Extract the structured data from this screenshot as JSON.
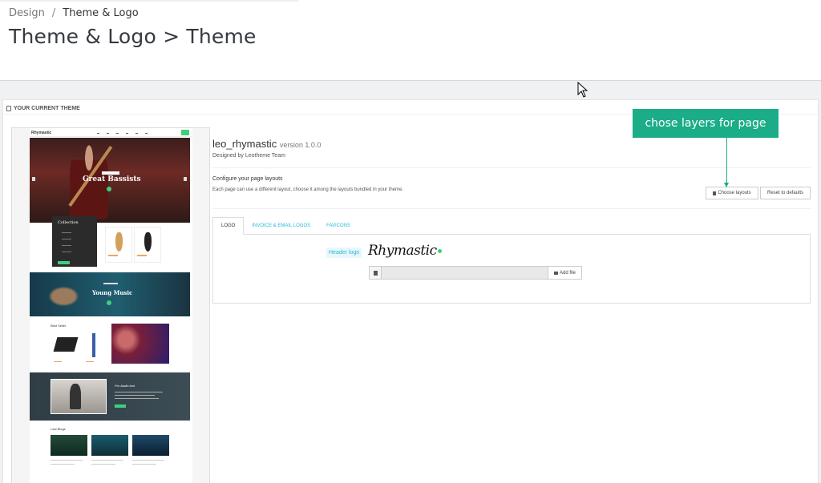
{
  "breadcrumb": {
    "parent": "Design",
    "separator": "/",
    "current": "Theme & Logo"
  },
  "page_title": "Theme & Logo > Theme",
  "panel": {
    "heading": "YOUR CURRENT THEME"
  },
  "preview": {
    "brand": "Rhymastic",
    "hero_title": "Great Bassists",
    "collection_title": "Collection",
    "band_title": "Young Music",
    "best_seller": "Best Seller",
    "feature_title": "Pro Audio tool",
    "blog_title": "Last Blogs"
  },
  "theme": {
    "name": "leo_rhymastic",
    "version": "version 1.0.0",
    "designed_by": "Designed by Leotheme Team"
  },
  "layouts": {
    "title": "Configure your page layouts",
    "description": "Each page can use a different layout, choose it among the layouts bundled in your theme.",
    "choose_button": "Choose layouts",
    "reset_button": "Reset to defaults"
  },
  "tabs": [
    {
      "label": "LOGO",
      "active": true
    },
    {
      "label": "INVOICE & EMAIL LOGOS",
      "active": false
    },
    {
      "label": "FAVICONS",
      "active": false
    }
  ],
  "logo_tab": {
    "header_logo_label": "Header logo",
    "logo_text": "Rhymastic",
    "add_file": "Add file"
  },
  "annotation": {
    "text": "chose layers for page",
    "color": "#1aad87"
  },
  "colors": {
    "link": "#25b9d7",
    "accent_green": "#3ecf7b"
  }
}
